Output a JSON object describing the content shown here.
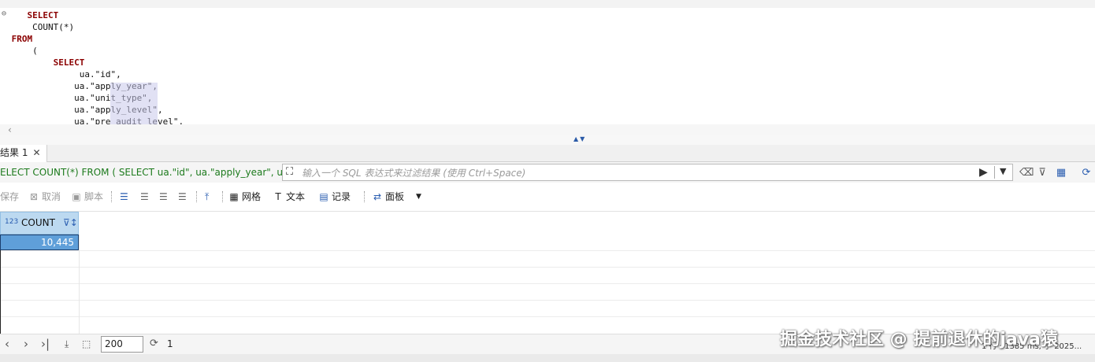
{
  "editor": {
    "lines": [
      {
        "indent": "    ",
        "kw": "SELECT",
        "text": ""
      },
      {
        "indent": "     ",
        "kw": "",
        "text": "COUNT(*)"
      },
      {
        "indent": " ",
        "kw": "FROM",
        "text": ""
      },
      {
        "indent": "     ",
        "kw": "",
        "text": "("
      },
      {
        "indent": "         ",
        "kw": "SELECT",
        "text": ""
      },
      {
        "indent": "              ",
        "kw": "",
        "text": "ua.\"id\","
      },
      {
        "indent": "             ",
        "kw": "",
        "text": "ua.\"apply_year\","
      },
      {
        "indent": "             ",
        "kw": "",
        "text": "ua.\"unit_type\","
      },
      {
        "indent": "             ",
        "kw": "",
        "text": "ua.\"apply_level\","
      },
      {
        "indent": "             ",
        "kw": "",
        "text": "ua.\"pre_audit_level\","
      }
    ]
  },
  "results_tab": {
    "label": "结果 1",
    "close": "✕"
  },
  "filter": {
    "sql_preview": "ELECT COUNT(*) FROM ( SELECT ua.\"id\", ua.\"apply_year\", ua.",
    "placeholder": "输入一个 SQL 表达式来过滤结果 (使用 Ctrl+Space)"
  },
  "toolbar": {
    "save": "保存",
    "cancel": "取消",
    "script": "脚本",
    "grid": "网格",
    "text": "文本",
    "record": "记录",
    "panel": "面板"
  },
  "grid": {
    "column": {
      "type_badge": "123",
      "name": "COUNT"
    },
    "value": "10,445"
  },
  "bottom": {
    "limit": "200",
    "count": "1",
    "status": "1 行 · 1385 ms, 于 2025..."
  },
  "watermark": "掘金技术社区 @ 提前退休的java猿"
}
